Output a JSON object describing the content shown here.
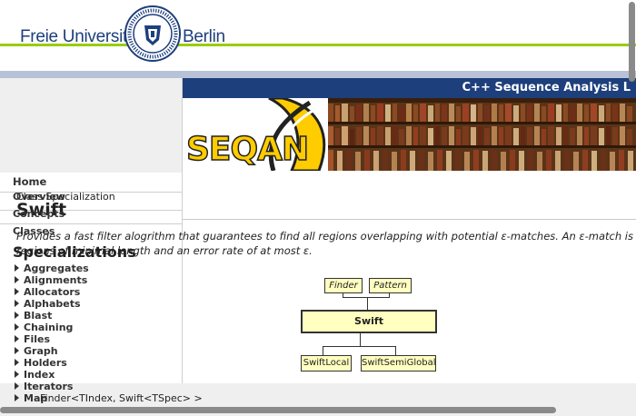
{
  "header": {
    "institution_left": "Freie Universität",
    "institution_right": "Berlin",
    "seal_text": "VERITAS IUSTITIA LIBERTAS · FREIE UNIVERSITÄT BERLIN"
  },
  "banner": {
    "title": "C++ Sequence Analysis L",
    "logo_text": "SEQAN"
  },
  "nav": {
    "home": "Home",
    "overview": "Overview",
    "concepts": "Concepts",
    "classes": "Classes",
    "items": [
      "Aggregates",
      "Alignments",
      "Allocators",
      "Alphabets",
      "Blast",
      "Chaining",
      "Files",
      "Graph",
      "Holders",
      "Index",
      "Iterators",
      "Map"
    ]
  },
  "content": {
    "class_spec_label": "Class Specialization",
    "class_name": "Swift",
    "description": "Provides a fast filter alogrithm that guarantees to find all regions overlapping with potential ε-matches. An ε-match is a",
    "description_line2": "regions of minimal length and an error rate of at most ε.",
    "specializations_heading": "Specializations",
    "signature": "Finder<TIndex, Swift<TSpec> >"
  },
  "diagram": {
    "finder": "Finder",
    "pattern": "Pattern",
    "main": "Swift",
    "child1": "SwiftLocal",
    "child2": "SwiftSemiGlobal"
  }
}
